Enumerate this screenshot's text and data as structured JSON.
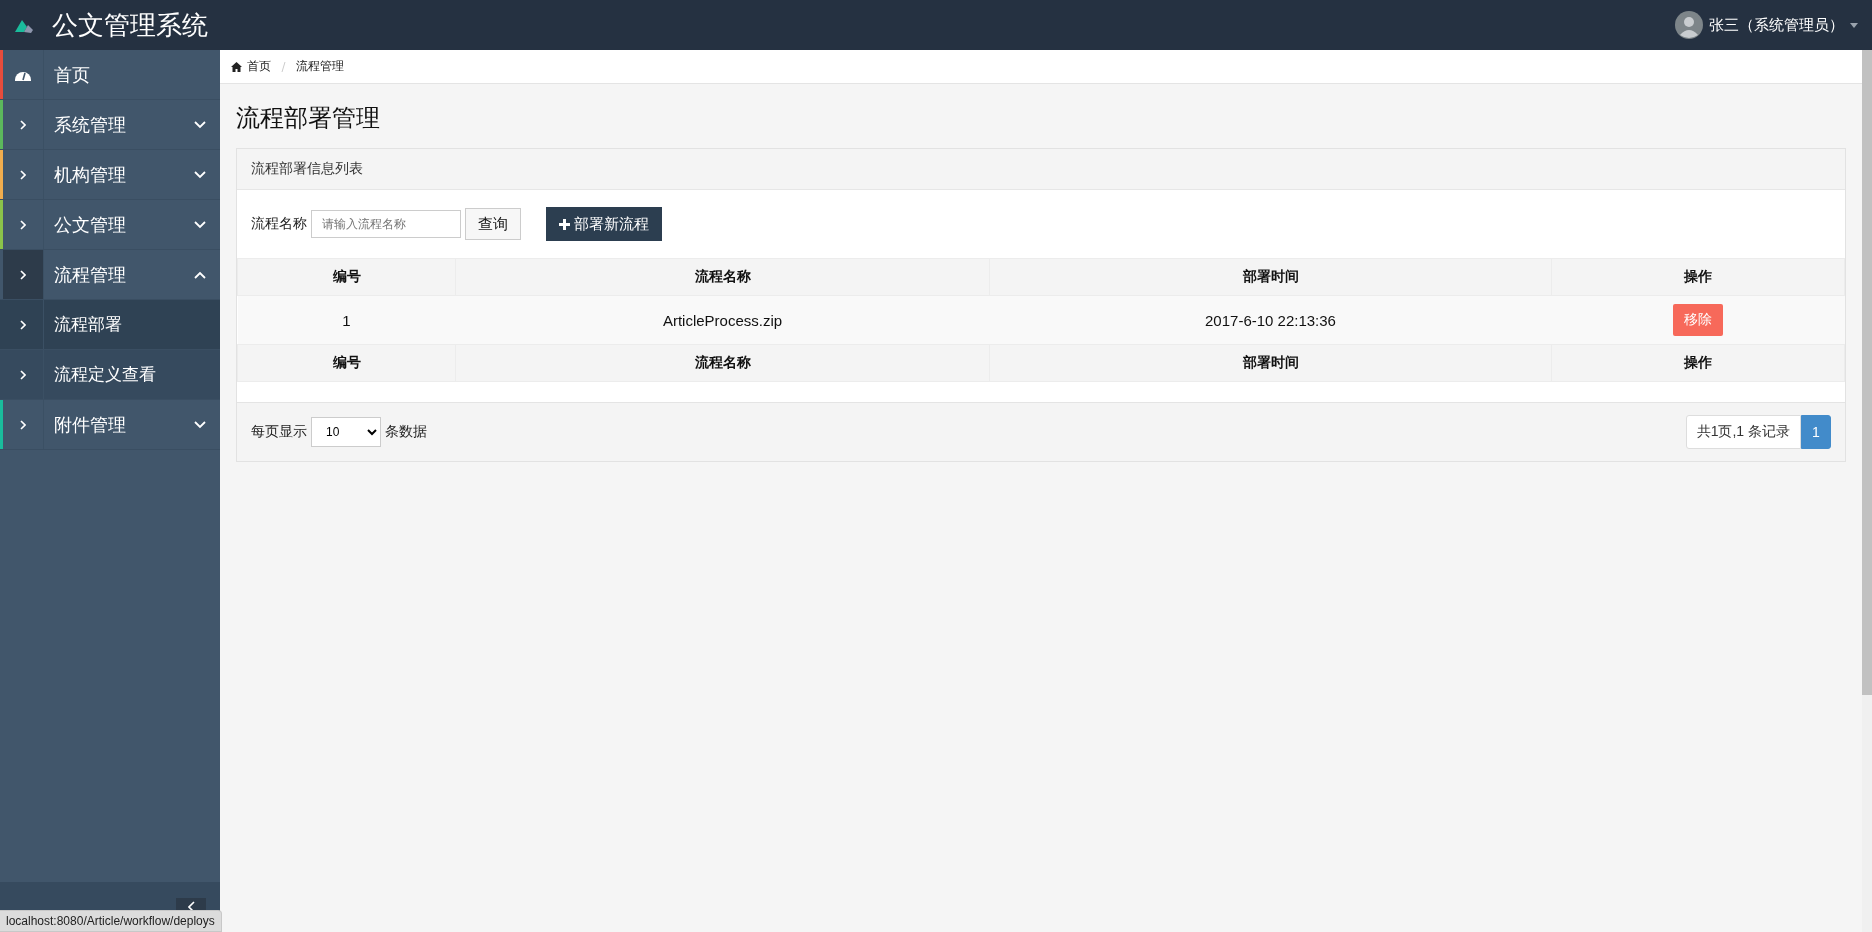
{
  "header": {
    "title": "公文管理系统",
    "user": {
      "name": "张三（系统管理员）"
    }
  },
  "sidebar": {
    "items": [
      {
        "label": "首页",
        "kind": "home",
        "color": "#e74c3c",
        "expanded": false
      },
      {
        "label": "系统管理",
        "kind": "group",
        "color": "#5cb85c",
        "expanded": false
      },
      {
        "label": "机构管理",
        "kind": "group",
        "color": "#f0ad4e",
        "expanded": false
      },
      {
        "label": "公文管理",
        "kind": "group",
        "color": "#8bc34a",
        "expanded": false
      },
      {
        "label": "流程管理",
        "kind": "group",
        "expanded": true,
        "children": [
          {
            "label": "流程部署",
            "selected": true
          },
          {
            "label": "流程定义查看",
            "selected": false
          }
        ]
      },
      {
        "label": "附件管理",
        "kind": "group",
        "color": "#1abc9c",
        "expanded": false
      }
    ]
  },
  "breadcrumb": [
    {
      "label": "首页",
      "kind": "home"
    },
    {
      "label": "流程管理",
      "kind": "page"
    }
  ],
  "page_title": "流程部署管理",
  "panel": {
    "title": "流程部署信息列表",
    "search": {
      "label": "流程名称",
      "placeholder": "请输入流程名称",
      "button": "查询"
    },
    "deploy_button": "部署新流程",
    "table": {
      "columns": [
        "编号",
        "流程名称",
        "部署时间",
        "操作"
      ],
      "rows": [
        {
          "cells": [
            "1",
            "ArticleProcess.zip",
            "2017-6-10 22:13:36"
          ],
          "action": "移除"
        }
      ],
      "footer_columns": [
        "编号",
        "流程名称",
        "部署时间",
        "操作"
      ]
    },
    "page_size": {
      "label": "每页显示",
      "value": "10",
      "unit": "条数据"
    },
    "pagination": {
      "summary": "共1页,1 条记录",
      "pages": [
        {
          "label": "1",
          "selected": true
        }
      ]
    }
  },
  "status_url": "localhost:8080/Article/workflow/deploys"
}
